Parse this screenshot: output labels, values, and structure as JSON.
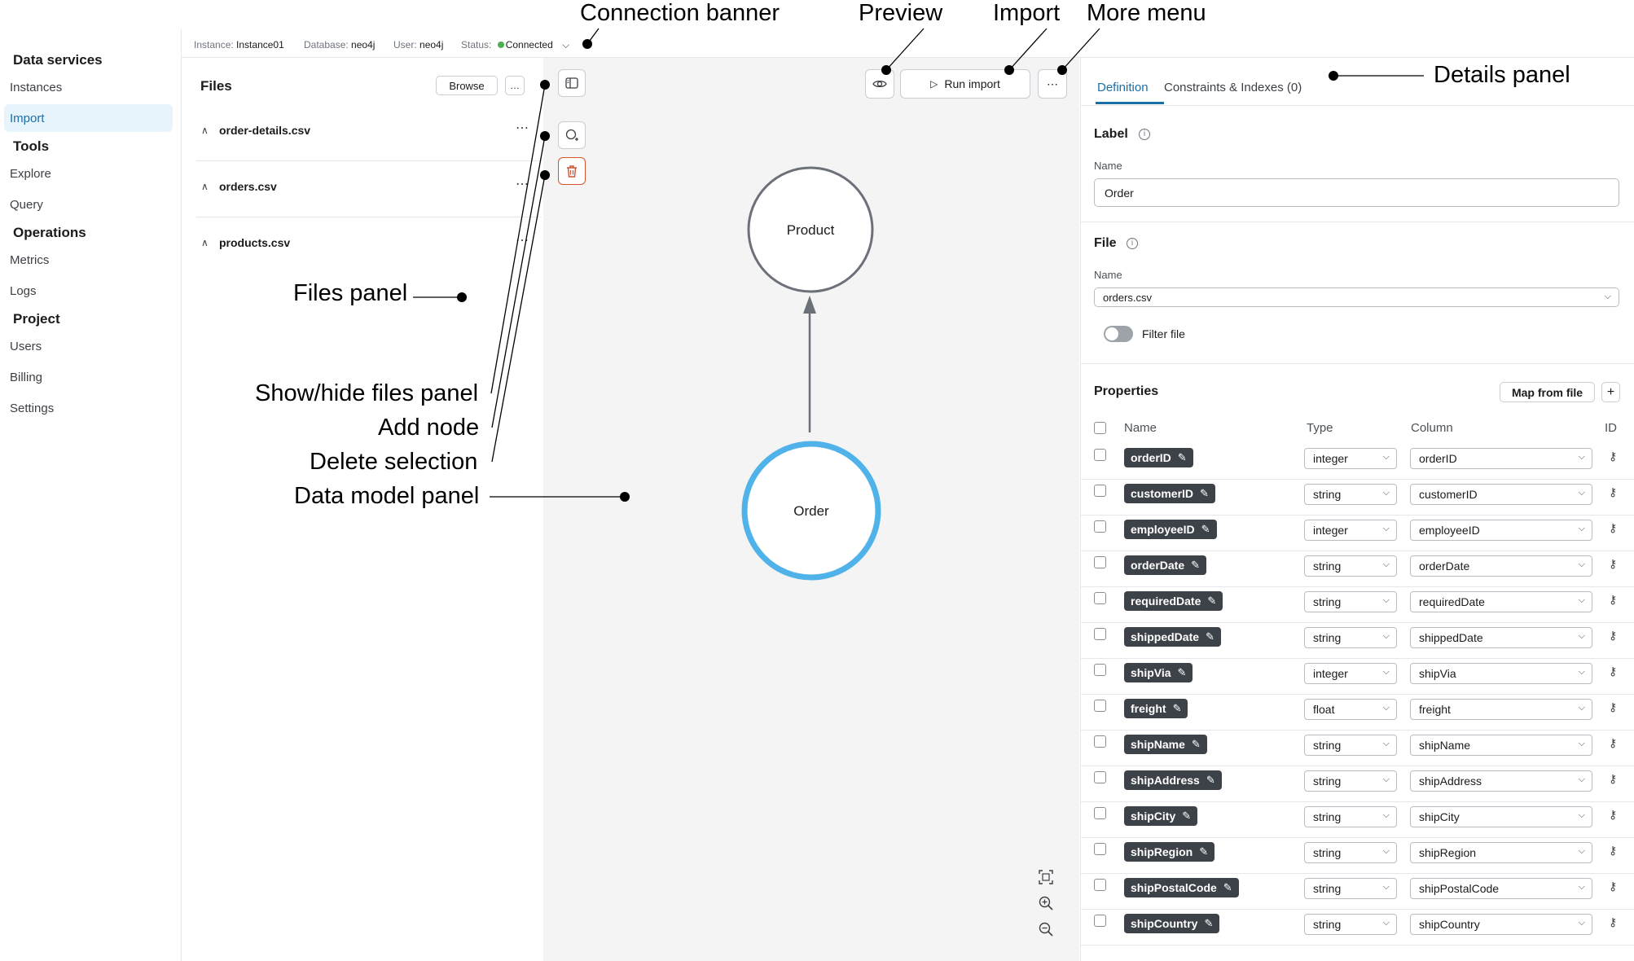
{
  "banner": {
    "instance_label": "Instance:",
    "instance": "Instance01",
    "database_label": "Database:",
    "database": "neo4j",
    "user_label": "User:",
    "user": "neo4j",
    "status_label": "Status:",
    "status": "Connected",
    "status_color": "#4caf50"
  },
  "sidebar": {
    "sections": [
      "Data services",
      "Tools",
      "Operations",
      "Project"
    ],
    "items": [
      "Instances",
      "Import",
      "Explore",
      "Query",
      "Metrics",
      "Logs",
      "Users",
      "Billing",
      "Settings"
    ],
    "active": "Import"
  },
  "files": {
    "title": "Files",
    "browse": "Browse",
    "list": [
      "order-details.csv",
      "orders.csv",
      "products.csv"
    ]
  },
  "canvas": {
    "run_import": "Run import",
    "nodes": [
      "Product",
      "Order"
    ],
    "selected_node_color": "#4fb3ea"
  },
  "details": {
    "tabs": [
      "Definition",
      "Constraints & Indexes (0)"
    ],
    "active_tab_color": "#1c6fa6",
    "label_section": "Label",
    "name_label": "Name",
    "label_value": "Order",
    "file_section": "File",
    "file_name_label": "Name",
    "file_value": "orders.csv",
    "filter_file": "Filter file",
    "properties_section": "Properties",
    "map_from_file": "Map from file",
    "columns": [
      "Name",
      "Type",
      "Column",
      "ID"
    ],
    "properties": [
      {
        "name": "orderID",
        "type": "integer",
        "column": "orderID"
      },
      {
        "name": "customerID",
        "type": "string",
        "column": "customerID"
      },
      {
        "name": "employeeID",
        "type": "integer",
        "column": "employeeID"
      },
      {
        "name": "orderDate",
        "type": "string",
        "column": "orderDate"
      },
      {
        "name": "requiredDate",
        "type": "string",
        "column": "requiredDate"
      },
      {
        "name": "shippedDate",
        "type": "string",
        "column": "shippedDate"
      },
      {
        "name": "shipVia",
        "type": "integer",
        "column": "shipVia"
      },
      {
        "name": "freight",
        "type": "float",
        "column": "freight"
      },
      {
        "name": "shipName",
        "type": "string",
        "column": "shipName"
      },
      {
        "name": "shipAddress",
        "type": "string",
        "column": "shipAddress"
      },
      {
        "name": "shipCity",
        "type": "string",
        "column": "shipCity"
      },
      {
        "name": "shipRegion",
        "type": "string",
        "column": "shipRegion"
      },
      {
        "name": "shipPostalCode",
        "type": "string",
        "column": "shipPostalCode"
      },
      {
        "name": "shipCountry",
        "type": "string",
        "column": "shipCountry"
      }
    ]
  },
  "annotations": {
    "connection_banner": "Connection banner",
    "preview": "Preview",
    "import": "Import",
    "more_menu": "More menu",
    "details_panel": "Details panel",
    "files_panel": "Files panel",
    "show_hide_files_panel": "Show/hide files panel",
    "add_node": "Add node",
    "delete_selection": "Delete selection",
    "data_model_panel": "Data model panel"
  }
}
